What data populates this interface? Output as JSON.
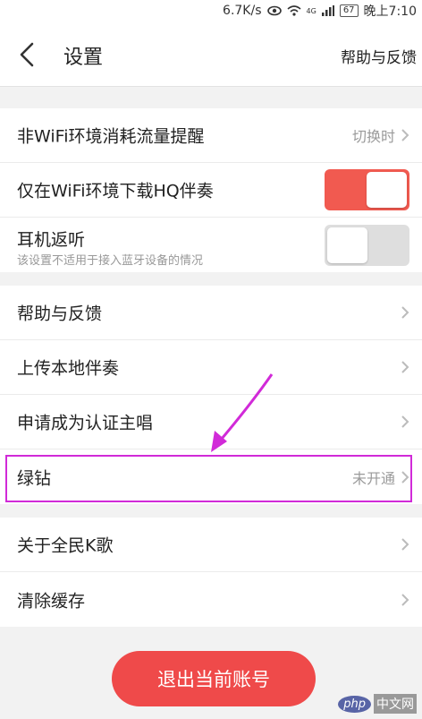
{
  "status_bar": {
    "speed": "6.7K/s",
    "signal_tag": "4G",
    "battery": "67",
    "time": "晚上7:10"
  },
  "header": {
    "title": "设置",
    "help_link": "帮助与反馈",
    "back_icon": "chevron-left-icon"
  },
  "network_group": {
    "non_wifi_label": "非WiFi环境消耗流量提醒",
    "non_wifi_value": "切换时",
    "hq_label": "仅在WiFi环境下载HQ伴奏",
    "hq_toggle": "on",
    "earphone_label": "耳机返听",
    "earphone_sub": "该设置不适用于接入蓝牙设备的情况",
    "earphone_toggle": "off"
  },
  "menu_group": {
    "help": "帮助与反馈",
    "upload": "上传本地伴奏",
    "apply": "申请成为认证主唱",
    "green_diamond": "绿钻",
    "green_diamond_value": "未开通"
  },
  "about_group": {
    "about": "关于全民K歌",
    "clear_cache": "清除缓存"
  },
  "logout_button": "退出当前账号",
  "watermark": {
    "logo": "php",
    "site": "中文网"
  },
  "colors": {
    "accent": "#ef4a4a",
    "toggle_on": "#f15a50",
    "annotation": "#d12ad8"
  }
}
